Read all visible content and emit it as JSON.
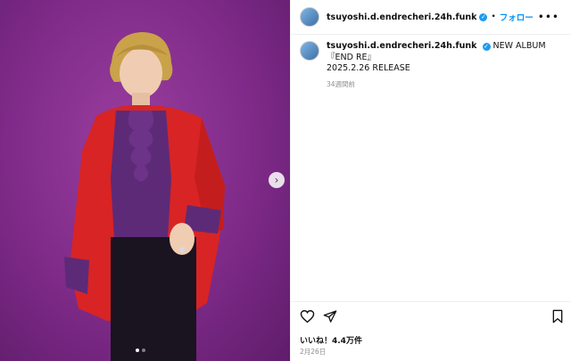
{
  "post": {
    "username": "tsuyoshi.d.endrecheri.24h.funk",
    "follow_label": "フォロー",
    "separator": "•",
    "more_label": "•••",
    "caption_lines": [
      "NEW ALBUM",
      "『END RE』",
      "2025.2.26 RELEASE"
    ],
    "caption_time": "34週間前",
    "likes_text": "いいね！4.4万件",
    "date_text": "2月26日"
  },
  "carousel": {
    "total_images": 2,
    "current_index": 1
  },
  "icons": {
    "like": "heart-icon",
    "share": "send-icon",
    "save": "bookmark-icon",
    "next": "chevron-right-icon",
    "verified": "verified-badge-icon"
  },
  "colors": {
    "accent": "#0095f6",
    "verified": "#1d9bf0",
    "background_photo": "#7e2a88"
  }
}
